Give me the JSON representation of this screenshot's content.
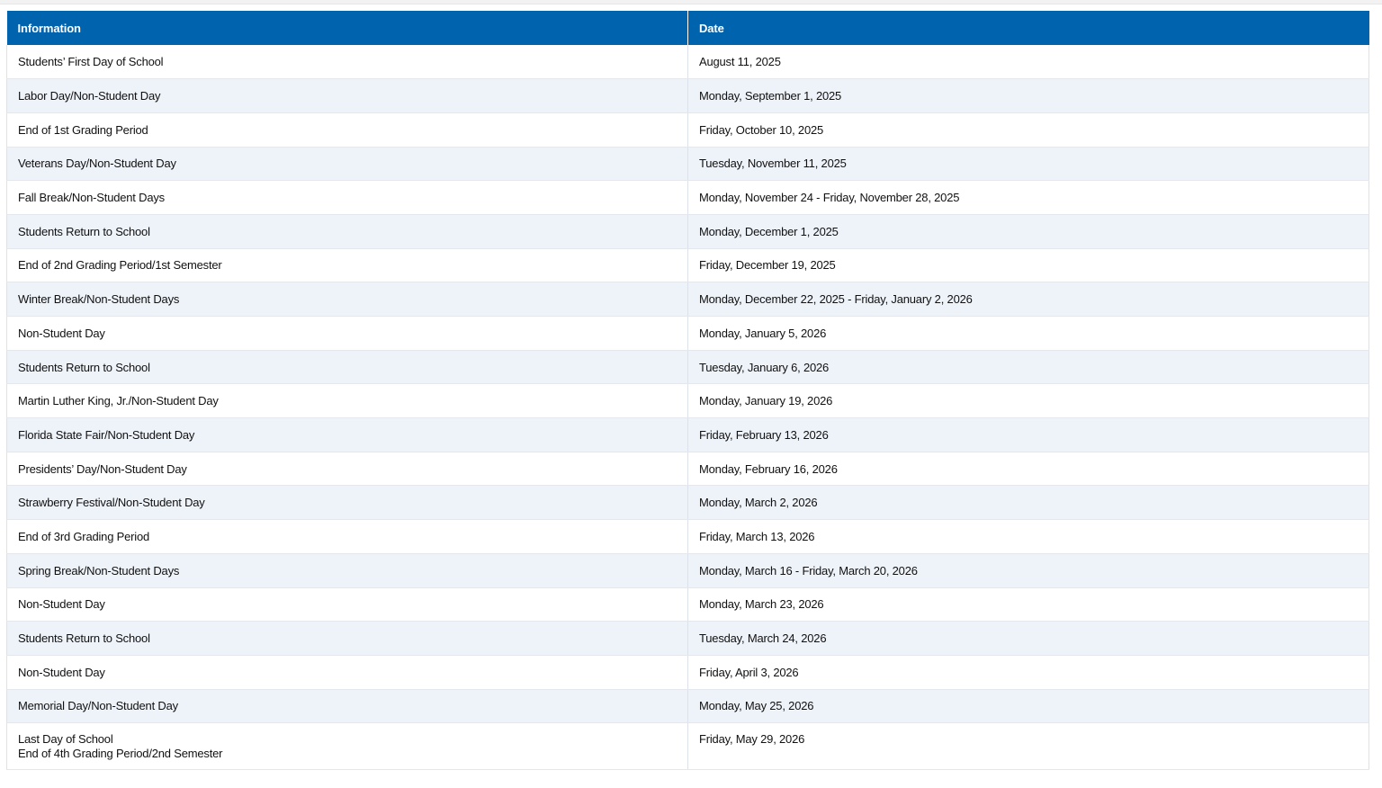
{
  "table": {
    "headers": {
      "info": "Information",
      "date": "Date"
    },
    "rows": [
      {
        "info": "Students’ First Day of School",
        "date": "August 11, 2025"
      },
      {
        "info": "Labor Day/Non-Student Day",
        "date": "Monday, September 1, 2025"
      },
      {
        "info": "End of 1st Grading Period",
        "date": "Friday, October 10, 2025"
      },
      {
        "info": "Veterans Day/Non-Student Day",
        "date": "Tuesday, November 11, 2025"
      },
      {
        "info": "Fall Break/Non-Student Days",
        "date": "Monday, November 24 - Friday, November 28, 2025"
      },
      {
        "info": "Students Return to School",
        "date": "Monday, December 1, 2025"
      },
      {
        "info": "End of 2nd Grading Period/1st Semester",
        "date": "Friday, December 19, 2025"
      },
      {
        "info": "Winter Break/Non-Student Days",
        "date": "Monday, December 22, 2025 - Friday, January 2, 2026"
      },
      {
        "info": "Non-Student Day",
        "date": "Monday, January 5, 2026"
      },
      {
        "info": "Students Return to School",
        "date": "Tuesday, January 6, 2026"
      },
      {
        "info": "Martin Luther King, Jr./Non-Student Day",
        "date": "Monday, January 19, 2026"
      },
      {
        "info": "Florida State Fair/Non-Student Day",
        "date": "Friday, February 13, 2026"
      },
      {
        "info": "Presidents’ Day/Non-Student Day",
        "date": "Monday, February 16, 2026"
      },
      {
        "info": "Strawberry Festival/Non-Student Day",
        "date": "Monday, March 2, 2026"
      },
      {
        "info": "End of 3rd Grading Period",
        "date": "Friday, March 13, 2026"
      },
      {
        "info": "Spring Break/Non-Student Days",
        "date": "Monday, March 16 - Friday, March 20, 2026"
      },
      {
        "info": "Non-Student Day",
        "date": "Monday, March 23, 2026"
      },
      {
        "info": "Students Return to School",
        "date": "Tuesday, March 24, 2026"
      },
      {
        "info": "Non-Student Day",
        "date": "Friday, April 3, 2026"
      },
      {
        "info": "Memorial Day/Non-Student Day",
        "date": "Monday, May 25, 2026"
      }
    ],
    "last_row": {
      "info_line1": "Last Day of School",
      "info_line2": "End of 4th Grading Period/2nd Semester",
      "date": "Friday, May 29, 2026"
    }
  },
  "colors": {
    "header_bg": "#0063ae",
    "header_text": "#ffffff",
    "row_alt_bg": "#eef3fa",
    "row_bg": "#ffffff"
  }
}
